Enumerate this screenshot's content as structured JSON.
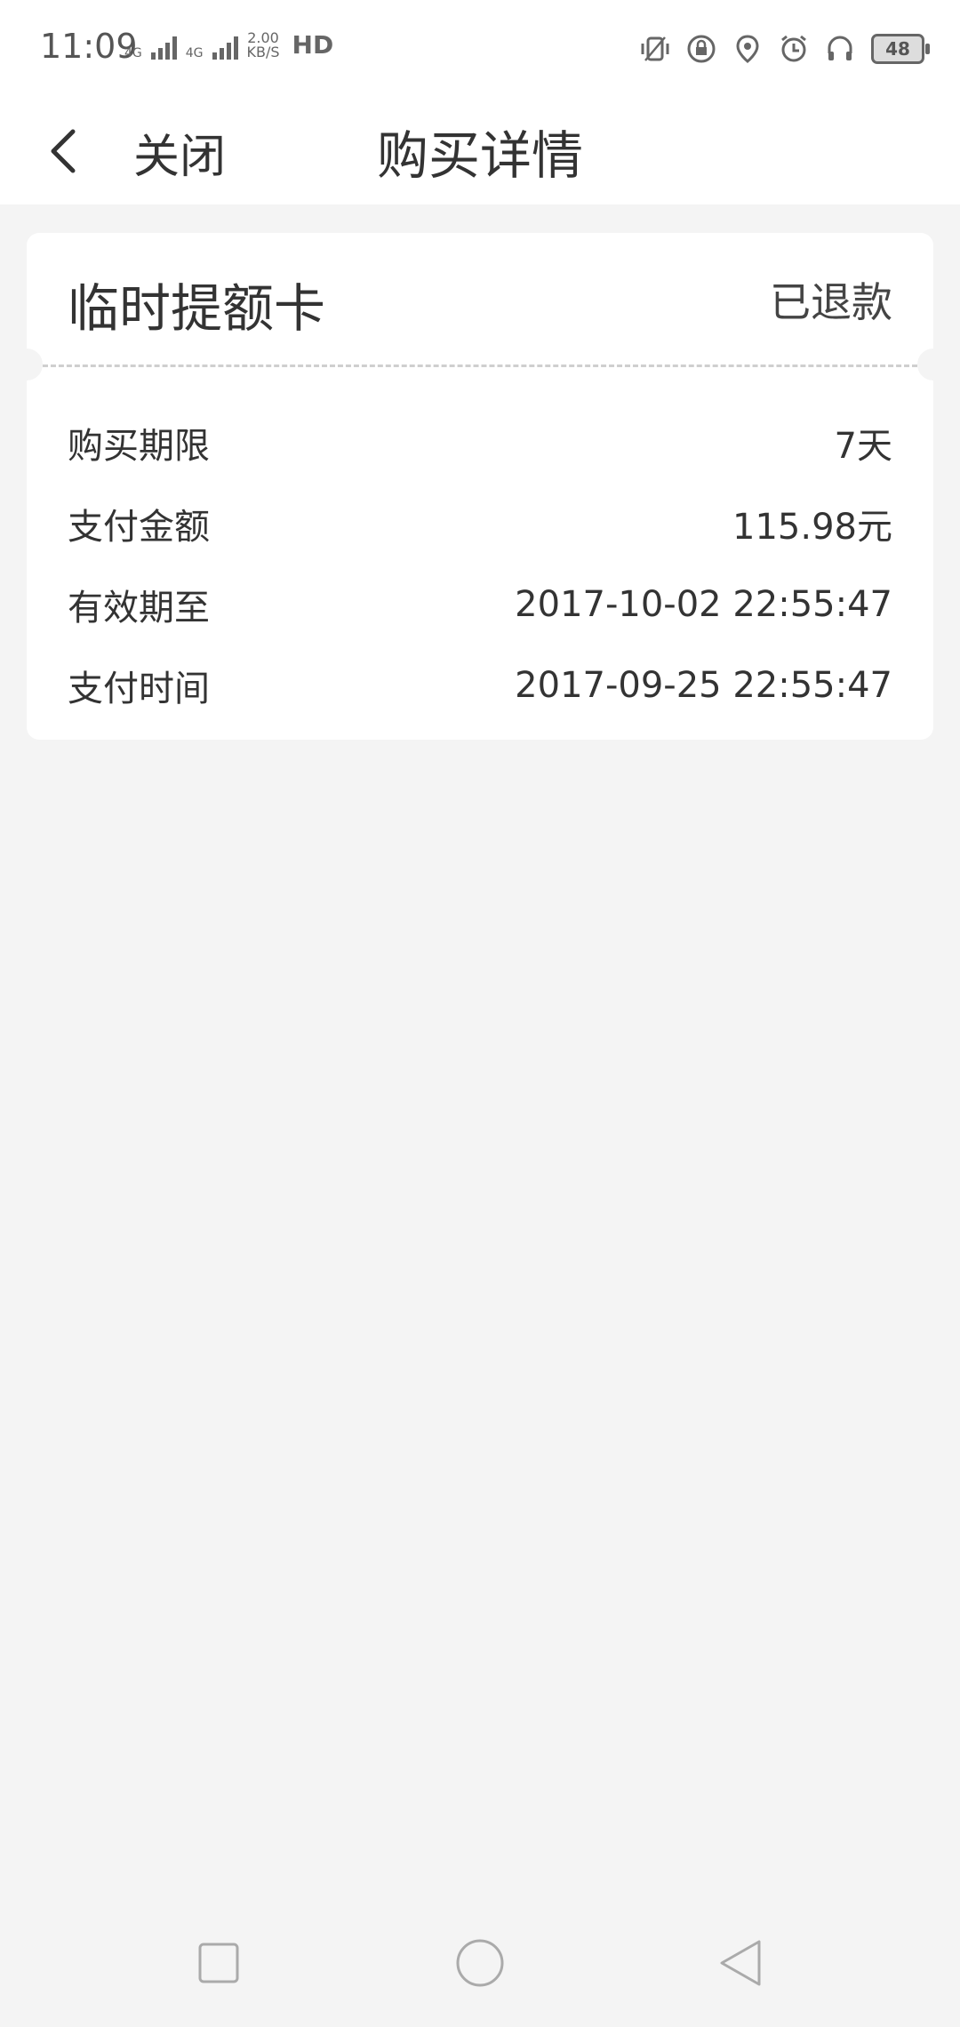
{
  "status_bar": {
    "time": "11:09",
    "network_small_1": "4G",
    "network_small_2": "4G",
    "speed_value": "2.00",
    "speed_unit": "KB/S",
    "hd_label": "HD",
    "battery": "48",
    "icons": [
      "vibrate-icon",
      "rotation-lock-icon",
      "location-icon",
      "alarm-icon",
      "headphones-icon",
      "battery-icon"
    ]
  },
  "nav": {
    "back_icon": "chevron-left-icon",
    "close_label": "关闭",
    "title": "购买详情"
  },
  "card": {
    "title": "临时提额卡",
    "status": "已退款",
    "rows": [
      {
        "label": "购买期限",
        "value": "7天"
      },
      {
        "label": "支付金额",
        "value": "115.98元"
      },
      {
        "label": "有效期至",
        "value": "2017-10-02 22:55:47"
      },
      {
        "label": "支付时间",
        "value": "2017-09-25 22:55:47"
      }
    ]
  },
  "system_nav": {
    "icons": [
      "recents-square-icon",
      "home-circle-icon",
      "back-triangle-icon"
    ]
  }
}
